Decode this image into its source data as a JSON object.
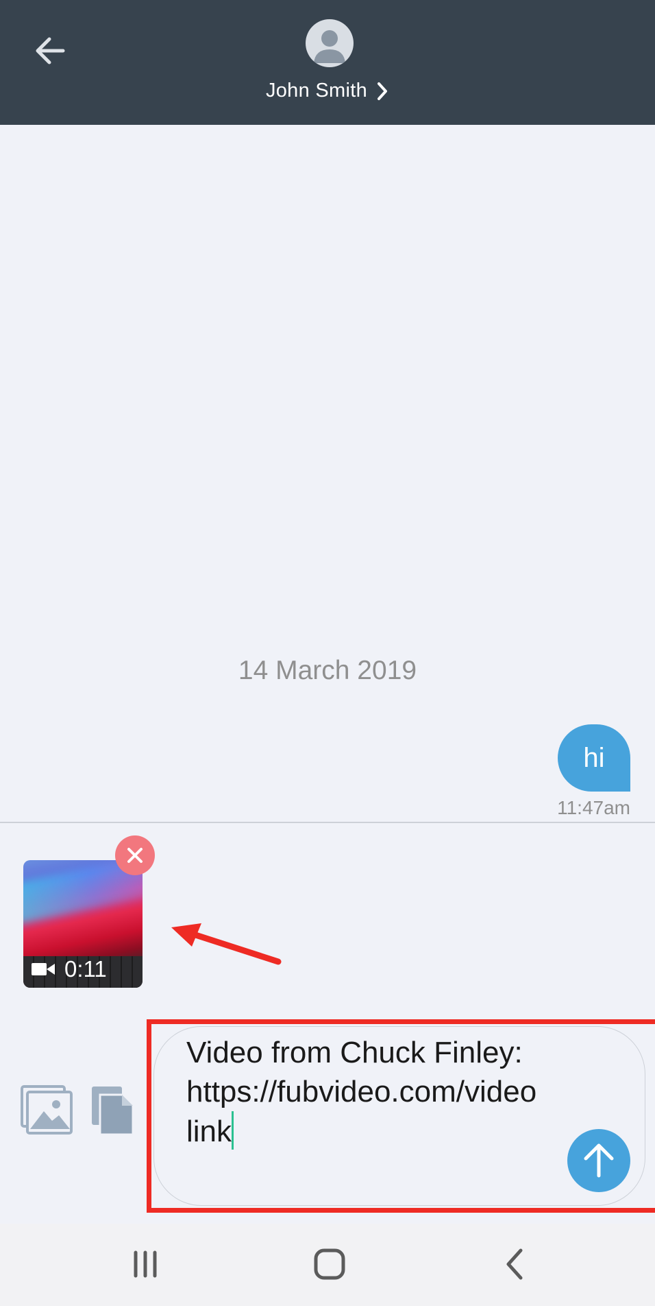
{
  "header": {
    "contact_name": "John Smith",
    "background_color": "#37434e"
  },
  "conversation": {
    "date_separator": "14 March 2019",
    "messages": [
      {
        "text": "hi",
        "time": "11:47am",
        "direction": "outgoing",
        "bubble_color": "#47a3dc"
      }
    ]
  },
  "attachment": {
    "type": "video",
    "duration": "0:11",
    "remove_icon": "close-icon"
  },
  "composer": {
    "message_text": "Video from Chuck Finley: https://fubvideo.com/videolink",
    "icons": [
      "gallery-icon",
      "file-icon",
      "send-arrow-icon"
    ],
    "send_color": "#47a3dc"
  },
  "nav_bar": {
    "icons": [
      "recent-apps-icon",
      "home-icon",
      "back-nav-icon"
    ]
  },
  "annotation": {
    "color": "#ee2b24"
  }
}
